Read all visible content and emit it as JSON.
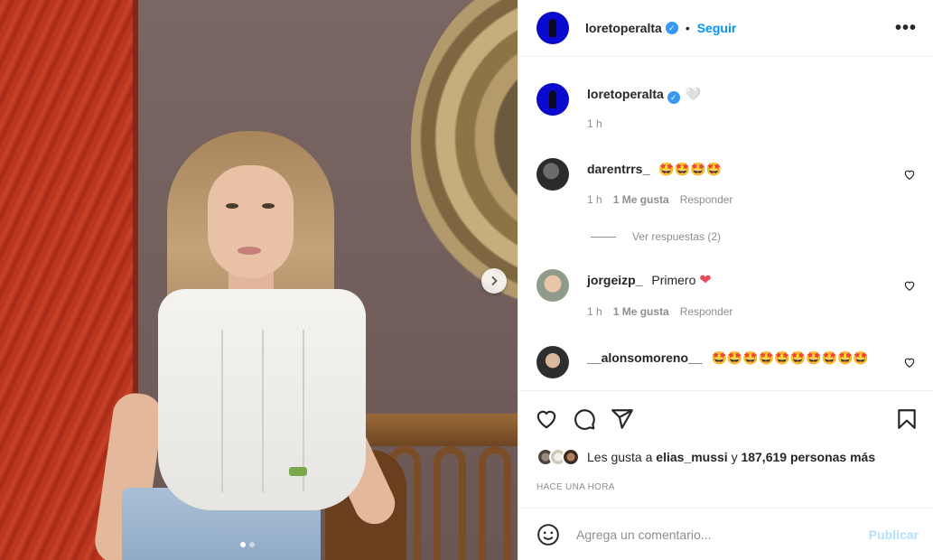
{
  "post": {
    "author": "loretoperalta",
    "follow_label": "Seguir",
    "separator": "•",
    "more_icon": "•••",
    "verified_icon": "✓"
  },
  "caption": {
    "username": "loretoperalta",
    "text": "🤍",
    "time": "1 h"
  },
  "comments": [
    {
      "username": "darentrrs_",
      "text": "🤩🤩🤩🤩",
      "time": "1 h",
      "likes": "1 Me gusta",
      "reply": "Responder",
      "view_replies": "Ver respuestas (2)"
    },
    {
      "username": "jorgeizp_",
      "text": "Primero",
      "heart": "❤",
      "time": "1 h",
      "likes": "1 Me gusta",
      "reply": "Responder"
    },
    {
      "username": "__alonsomoreno__",
      "text": "🤩🤩🤩🤩🤩🤩🤩🤩🤩🤩"
    }
  ],
  "likes": {
    "prefix": "Les gusta a",
    "user": "elias_mussi",
    "connector": "y",
    "count": "187,619 personas más"
  },
  "posted_time": "HACE UNA HORA",
  "comment_box": {
    "placeholder": "Agrega un comentario...",
    "publish": "Publicar"
  },
  "carousel": {
    "current": 1,
    "total": 2
  }
}
